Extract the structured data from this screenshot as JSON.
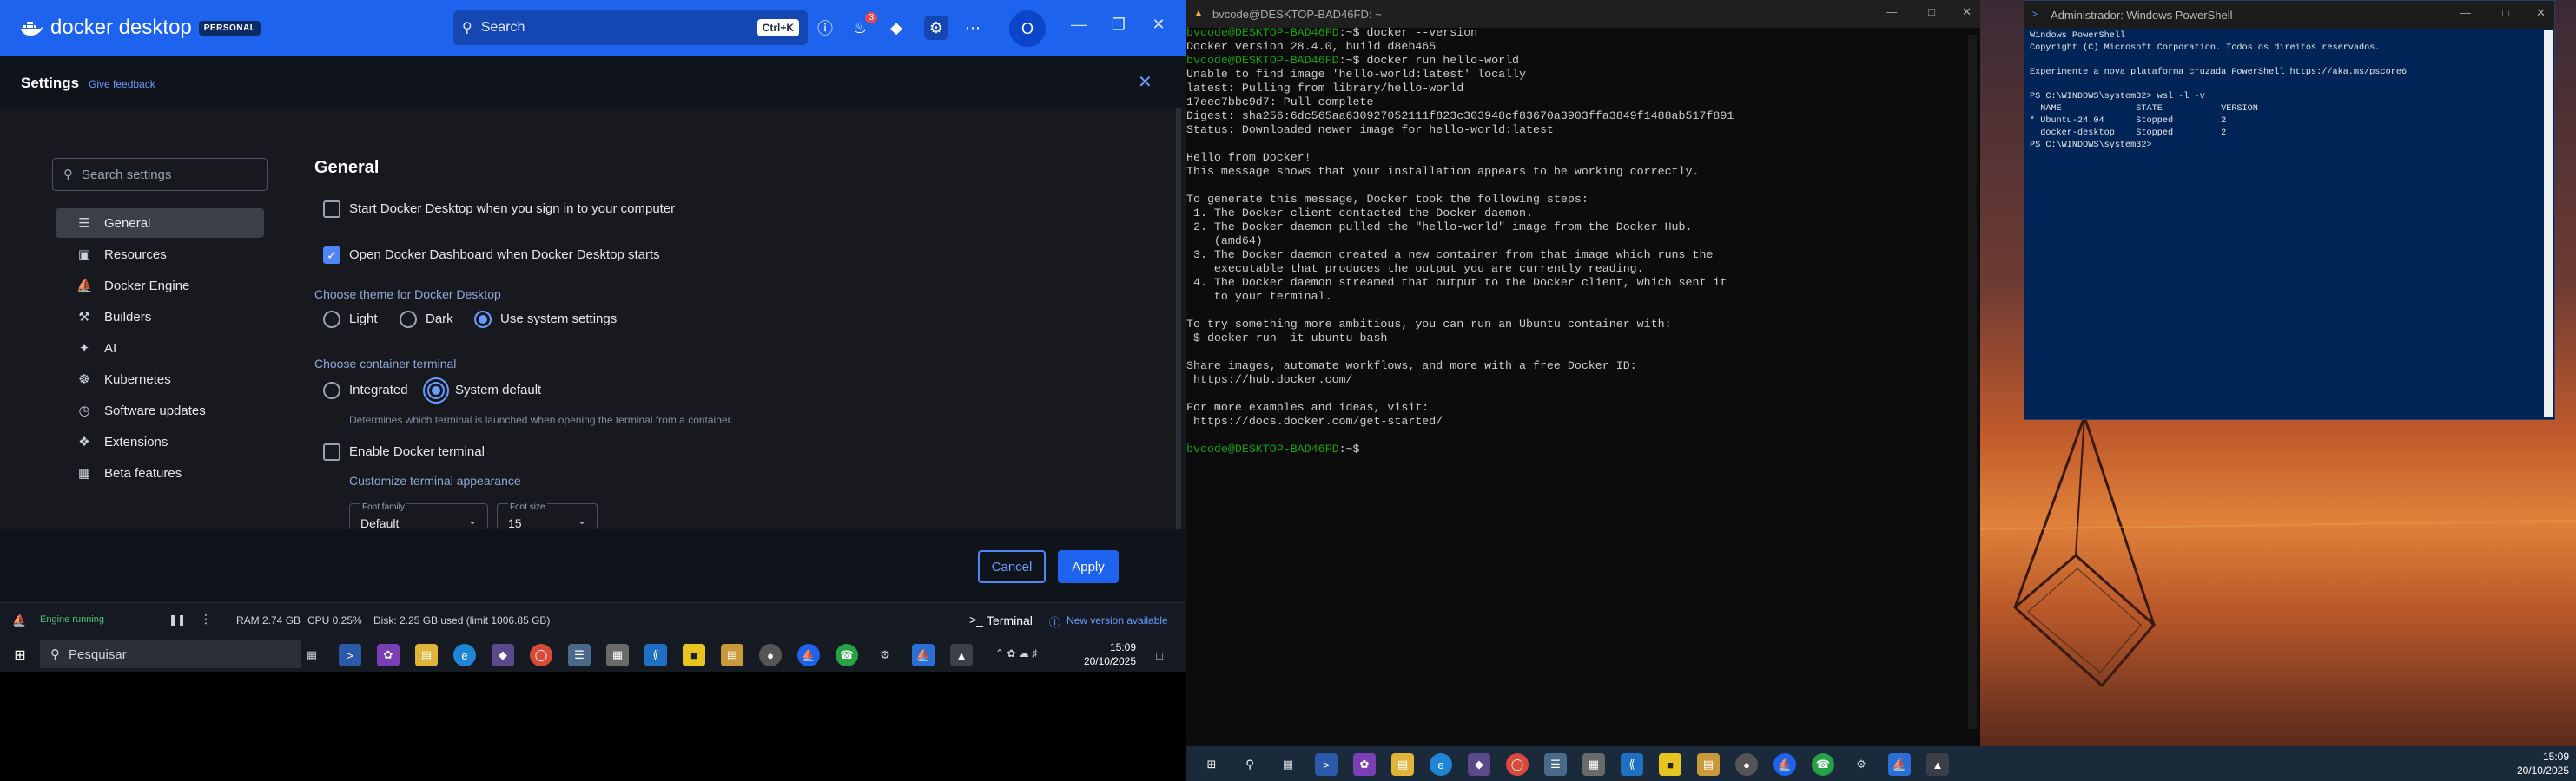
{
  "docker": {
    "app_name": "docker desktop",
    "plan_badge": "PERSONAL",
    "search": {
      "placeholder": "Search",
      "shortcut": "Ctrl+K"
    },
    "notifications_count": "3",
    "avatar_initial": "O",
    "settings_title": "Settings",
    "give_feedback": "Give feedback",
    "sidebar_search_placeholder": "Search settings",
    "sidebar": [
      {
        "label": "General",
        "icon": "sliders-icon",
        "active": true
      },
      {
        "label": "Resources",
        "icon": "resources-icon"
      },
      {
        "label": "Docker Engine",
        "icon": "whale-icon"
      },
      {
        "label": "Builders",
        "icon": "wrench-icon"
      },
      {
        "label": "AI",
        "icon": "ai-icon"
      },
      {
        "label": "Kubernetes",
        "icon": "helm-icon"
      },
      {
        "label": "Software updates",
        "icon": "clock-icon"
      },
      {
        "label": "Extensions",
        "icon": "puzzle-icon"
      },
      {
        "label": "Beta features",
        "icon": "grid-icon"
      }
    ],
    "general": {
      "title": "General",
      "start_on_signin": "Start Docker Desktop when you sign in to your computer",
      "open_dashboard": "Open Docker Dashboard when Docker Desktop starts",
      "theme_label": "Choose theme for Docker Desktop",
      "theme_options": [
        "Light",
        "Dark",
        "Use system settings"
      ],
      "theme_selected": "Use system settings",
      "terminal_label": "Choose container terminal",
      "terminal_options": [
        "Integrated",
        "System default"
      ],
      "terminal_selected": "System default",
      "terminal_hint": "Determines which terminal is launched when opening the terminal from a container.",
      "enable_terminal": "Enable Docker terminal",
      "customize_terminal": "Customize terminal appearance",
      "font_family_label": "Font family",
      "font_family_value": "Default",
      "font_size_label": "Font size",
      "font_size_value": "15"
    },
    "buttons": {
      "cancel": "Cancel",
      "apply": "Apply"
    },
    "status": {
      "engine": "Engine running",
      "ram": "RAM 2.74 GB",
      "cpu": "CPU 0.25%",
      "disk": "Disk: 2.25 GB used (limit 1006.85 GB)",
      "terminal": "Terminal",
      "new_version": "New version available"
    }
  },
  "taskbar_left": {
    "search_placeholder": "Pesquisar",
    "time": "15:09",
    "date": "20/10/2025"
  },
  "terminal": {
    "title": "bvcode@DESKTOP-BAD46FD: ~",
    "lines": [
      {
        "prompt": "bvcode@DESKTOP-BAD46FD",
        "cmd": ":~$ docker --version"
      },
      {
        "text": "Docker version 28.4.0, build d8eb465"
      },
      {
        "prompt": "bvcode@DESKTOP-BAD46FD",
        "cmd": ":~$ docker run hello-world"
      },
      {
        "text": "Unable to find image 'hello-world:latest' locally"
      },
      {
        "text": "latest: Pulling from library/hello-world"
      },
      {
        "text": "17eec7bbc9d7: Pull complete"
      },
      {
        "text": "Digest: sha256:6dc565aa630927052111f823c303948cf83670a3903ffa3849f1488ab517f891"
      },
      {
        "text": "Status: Downloaded newer image for hello-world:latest"
      },
      {
        "text": ""
      },
      {
        "text": "Hello from Docker!"
      },
      {
        "text": "This message shows that your installation appears to be working correctly."
      },
      {
        "text": ""
      },
      {
        "text": "To generate this message, Docker took the following steps:"
      },
      {
        "text": " 1. The Docker client contacted the Docker daemon."
      },
      {
        "text": " 2. The Docker daemon pulled the \"hello-world\" image from the Docker Hub."
      },
      {
        "text": "    (amd64)"
      },
      {
        "text": " 3. The Docker daemon created a new container from that image which runs the"
      },
      {
        "text": "    executable that produces the output you are currently reading."
      },
      {
        "text": " 4. The Docker daemon streamed that output to the Docker client, which sent it"
      },
      {
        "text": "    to your terminal."
      },
      {
        "text": ""
      },
      {
        "text": "To try something more ambitious, you can run an Ubuntu container with:"
      },
      {
        "text": " $ docker run -it ubuntu bash"
      },
      {
        "text": ""
      },
      {
        "text": "Share images, automate workflows, and more with a free Docker ID:"
      },
      {
        "text": " https://hub.docker.com/"
      },
      {
        "text": ""
      },
      {
        "text": "For more examples and ideas, visit:"
      },
      {
        "text": " https://docs.docker.com/get-started/"
      },
      {
        "text": ""
      },
      {
        "prompt": "bvcode@DESKTOP-BAD46FD",
        "cmd": ":~$"
      }
    ]
  },
  "powershell": {
    "title": "Administrador: Windows PowerShell",
    "lines": [
      "Windows PowerShell",
      "Copyright (C) Microsoft Corporation. Todos os direitos reservados.",
      "",
      "Experimente a nova plataforma cruzada PowerShell https://aka.ms/pscore6",
      "",
      "PS C:\\WINDOWS\\system32> wsl -l -v",
      "  NAME              STATE           VERSION",
      "* Ubuntu-24.04      Stopped         2",
      "  docker-desktop    Stopped         2",
      "PS C:\\WINDOWS\\system32>"
    ]
  },
  "taskbar_right": {
    "time": "15:09",
    "date": "20/10/2025"
  }
}
